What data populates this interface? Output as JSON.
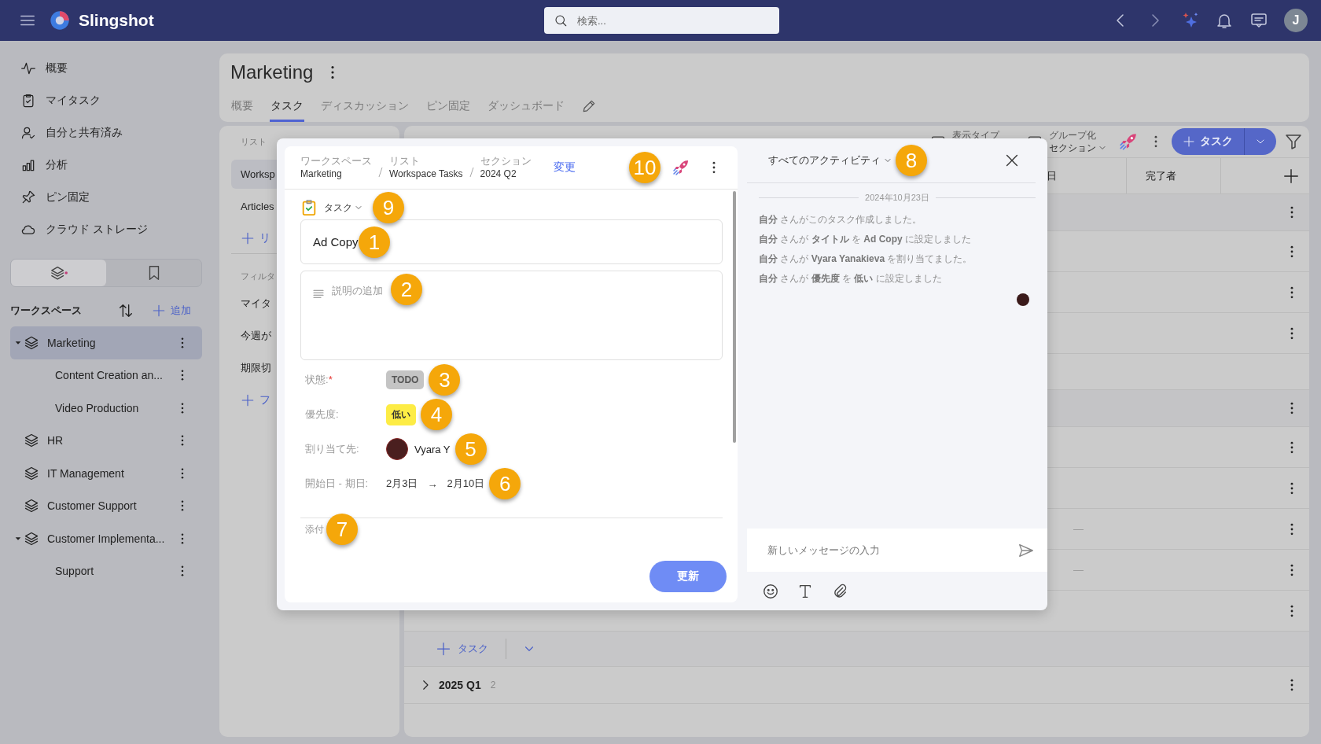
{
  "topbar": {
    "app_name": "Slingshot",
    "search_placeholder": "検索...",
    "avatar_initial": "J"
  },
  "sidebar": {
    "nav": [
      {
        "label": "概要"
      },
      {
        "label": "マイタスク"
      },
      {
        "label": "自分と共有済み"
      },
      {
        "label": "分析"
      },
      {
        "label": "ピン固定"
      },
      {
        "label": "クラウド ストレージ"
      }
    ],
    "view_tabs": [
      {
        "kind": "workspaces",
        "selected": true
      },
      {
        "kind": "bookmarks",
        "selected": false
      }
    ],
    "workspaces_title": "ワークスペース",
    "add_label": "追加",
    "workspaces": [
      {
        "label": "Marketing",
        "selected": true,
        "expanded": true,
        "children": [
          {
            "label": "Content Creation an...",
            "selected": false
          },
          {
            "label": "Video Production",
            "selected": false
          }
        ]
      },
      {
        "label": "HR",
        "selected": false,
        "expanded": false
      },
      {
        "label": "IT Management",
        "selected": false,
        "expanded": false
      },
      {
        "label": "Customer Support",
        "selected": false,
        "expanded": false
      },
      {
        "label": "Customer Implementa...",
        "selected": false,
        "expanded": true,
        "children": [
          {
            "label": "Support",
            "selected": false
          }
        ]
      }
    ]
  },
  "project": {
    "title": "Marketing",
    "tabs": [
      {
        "label": "概要",
        "selected": false
      },
      {
        "label": "タスク",
        "selected": true
      },
      {
        "label": "ディスカッション",
        "selected": false
      },
      {
        "label": "ピン固定",
        "selected": false
      },
      {
        "label": "ダッシュボード",
        "selected": false
      }
    ]
  },
  "lists_panel": {
    "heading": "リスト",
    "lists": [
      {
        "label": "Worksp",
        "selected": true
      },
      {
        "label": "Articles",
        "selected": false
      }
    ],
    "add_list": "リ",
    "filters_heading": "フィルタ",
    "filters": [
      {
        "label": "マイタ"
      },
      {
        "label": "今週が"
      },
      {
        "label": "期限切"
      }
    ],
    "add_filter": "フ"
  },
  "table": {
    "toolbar": {
      "view_type": "表示タイプ",
      "group_by": "グループ化",
      "group_value": "セクション",
      "add_task": "タスク"
    },
    "columns": [
      {
        "label": "日"
      },
      {
        "label": "完了者"
      }
    ],
    "rows": [
      {
        "kind": "group"
      },
      {
        "kind": "task"
      },
      {
        "kind": "task"
      },
      {
        "kind": "task"
      },
      {
        "kind": "blank"
      },
      {
        "kind": "group"
      },
      {
        "kind": "task"
      },
      {
        "kind": "task"
      },
      {
        "kind": "task",
        "value": "—"
      },
      {
        "kind": "task",
        "value": "—"
      },
      {
        "kind": "task"
      }
    ],
    "add_task": "タスク",
    "sections": [
      {
        "title": "2025 Q1",
        "count": "2",
        "expanded": false
      }
    ]
  },
  "task_modal": {
    "breadcrumb": [
      {
        "caption": "ワークスペース",
        "value": "Marketing"
      },
      {
        "caption": "リスト",
        "value": "Workspace Tasks"
      },
      {
        "caption": "セクション",
        "value": "2024 Q2"
      }
    ],
    "change_link": "変更",
    "header_callout": "10",
    "type": {
      "label": "タスク",
      "callout": "9"
    },
    "title": {
      "value": "Ad Copy",
      "callout": "1"
    },
    "description": {
      "placeholder": "説明の追加",
      "callout": "2"
    },
    "fields": [
      {
        "kind": "status",
        "label": "状態:",
        "required_mark": "*",
        "value": "TODO",
        "callout": "3"
      },
      {
        "kind": "priority",
        "label": "優先度:",
        "value": "低い",
        "callout": "4"
      },
      {
        "kind": "assignee",
        "label": "割り当て先:",
        "value": "Vyara Y",
        "callout": "5"
      },
      {
        "kind": "dates",
        "label": "開始日 - 期日:",
        "start": "2月3日",
        "arrow": "→",
        "end": "2月10日",
        "callout": "6"
      }
    ],
    "attachments": {
      "label": "添付",
      "callout": "7"
    },
    "update_button": "更新"
  },
  "activity": {
    "filter": "すべてのアクティビティ",
    "callout": "8",
    "date": "2024年10月23日",
    "entries": [
      "**自分** さんがこのタスク作成しました。",
      "**自分** さんが **タイトル** を **Ad Copy** に設定しました",
      "**自分** さんが **Vyara Yanakieva** を割り当てました。",
      "**自分** さんが **優先度** を **低い** に設定しました"
    ],
    "message_placeholder": "新しいメッセージの入力"
  }
}
